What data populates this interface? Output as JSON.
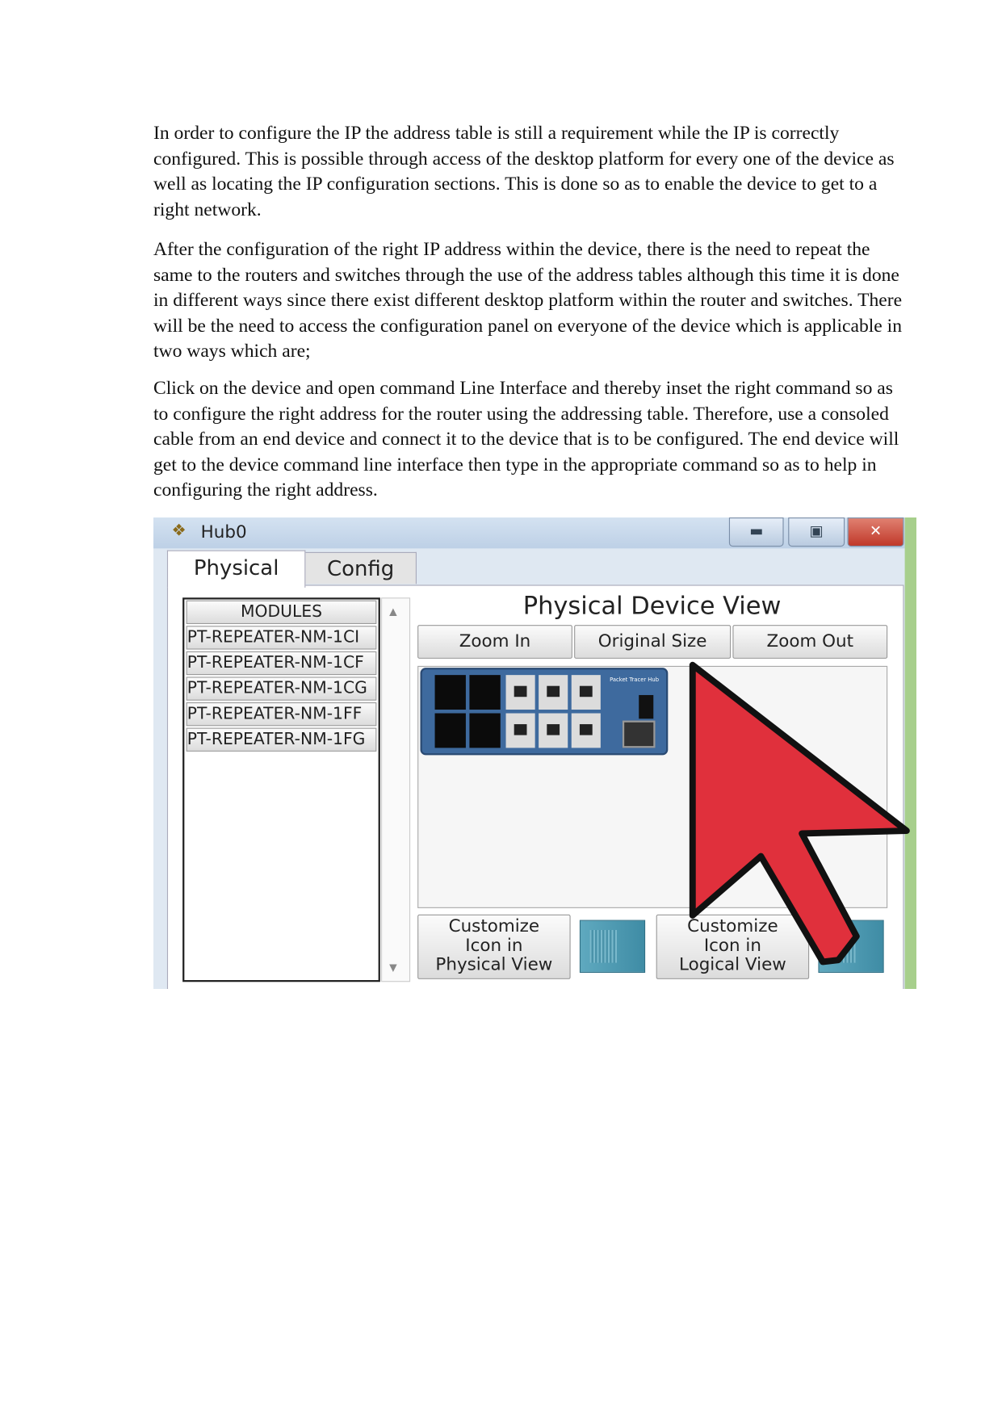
{
  "document": {
    "paragraphs": [
      "In order to configure the IP the address table is still a requirement while the IP is correctly configured. This is possible through access of the desktop platform for every one of the device as well as locating the IP configuration sections. This is done so as to enable the device to get to a right network.",
      "After the configuration of the right IP address within the device, there is the need to repeat the same to the routers and switches through the use of the address tables although this time it is done in different ways since there exist different desktop platform within the router and switches.  There will be the need to access the configuration panel on everyone of the device which is applicable in two ways which are;",
      "Click on the device and open command Line Interface and thereby inset the right command so as to configure the right address for the router using the addressing table. Therefore, use a consoled cable from an end device and connect it to the device that is to be configured. The end device will get to the device command line interface then type in the appropriate command so as to help in configuring the right address."
    ]
  },
  "screenshot": {
    "window_title": "Hub0",
    "app_icon": "packet-tracer-icon",
    "window_buttons": {
      "minimize": "minimize-icon",
      "maximize": "maximize-icon",
      "close": "close-icon"
    },
    "tabs": [
      {
        "label": "Physical",
        "active": true
      },
      {
        "label": "Config",
        "active": false
      }
    ],
    "modules": {
      "header": "MODULES",
      "items": [
        "PT-REPEATER-NM-1CI",
        "PT-REPEATER-NM-1CF",
        "PT-REPEATER-NM-1CG",
        "PT-REPEATER-NM-1FF",
        "PT-REPEATER-NM-1FG"
      ]
    },
    "device_view": {
      "title": "Physical Device View",
      "zoom_in": "Zoom In",
      "original_size": "Original Size",
      "zoom_out": "Zoom Out",
      "device_label": "Packet Tracer Hub"
    },
    "customize_physical": [
      "Customize",
      "Icon in",
      "Physical View"
    ],
    "customize_logical": [
      "Customize",
      "Icon in",
      "Logical View"
    ],
    "colors": {
      "arrow": "#e0303c",
      "device": "#3e6a9e",
      "accent_green": "#a7cf8c"
    }
  }
}
